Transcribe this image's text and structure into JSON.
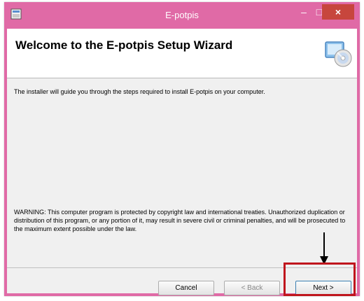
{
  "window": {
    "title": "E-potpis",
    "minimize_glyph": "–",
    "maximize_glyph": "□",
    "close_glyph": "×",
    "frame_color": "#e06aa6",
    "close_color": "#c7463d"
  },
  "header": {
    "heading": "Welcome to the E-potpis Setup Wizard",
    "icon": "setup-cd-icon"
  },
  "content": {
    "intro": "The installer will guide you through the steps required to install E-potpis on your computer.",
    "warning": "WARNING: This computer program is protected by copyright law and international treaties. Unauthorized duplication or distribution of this program, or any portion of it, may result in severe civil or criminal penalties, and will be prosecuted to the maximum extent possible under the law."
  },
  "footer": {
    "cancel_label": "Cancel",
    "back_label": "< Back",
    "next_label": "Next >"
  },
  "annotation": {
    "highlight_color": "#c0161d",
    "arrow_icon": "down-arrow-icon"
  }
}
